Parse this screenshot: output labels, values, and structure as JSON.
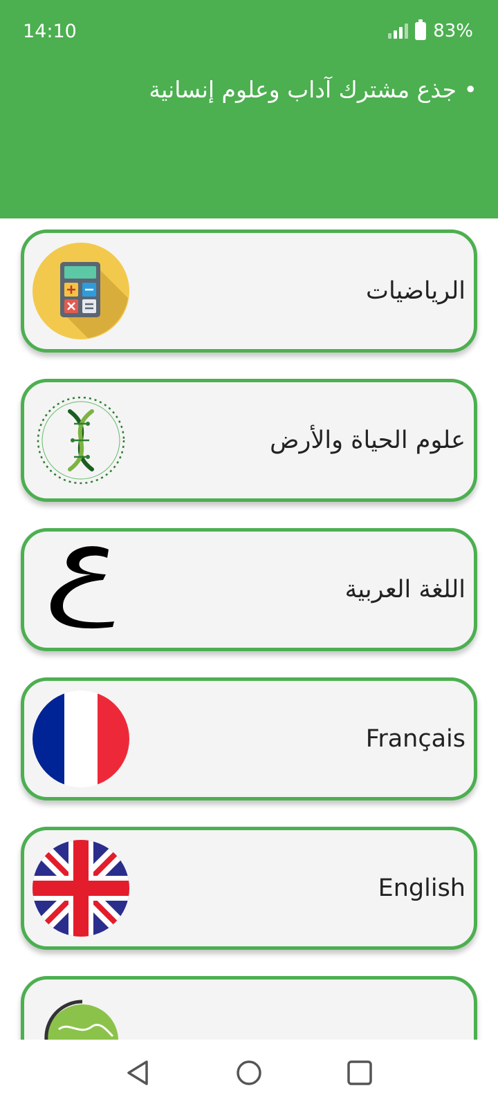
{
  "status_bar": {
    "time": "14:10",
    "battery": "83%"
  },
  "header": {
    "title": "• جذع مشترك آداب وعلوم إنسانية"
  },
  "subjects": [
    {
      "label": "الرياضيات",
      "icon": "calculator-icon"
    },
    {
      "label": "علوم الحياة والأرض",
      "icon": "dna-icon"
    },
    {
      "label": "اللغة العربية",
      "icon": "arabic-letter-ain-icon"
    },
    {
      "label": "Français",
      "icon": "france-flag-icon"
    },
    {
      "label": "English",
      "icon": "uk-flag-icon"
    },
    {
      "label": "",
      "icon": "globe-icon"
    }
  ],
  "colors": {
    "accent": "#4caf50",
    "card_bg": "#f4f4f4"
  }
}
